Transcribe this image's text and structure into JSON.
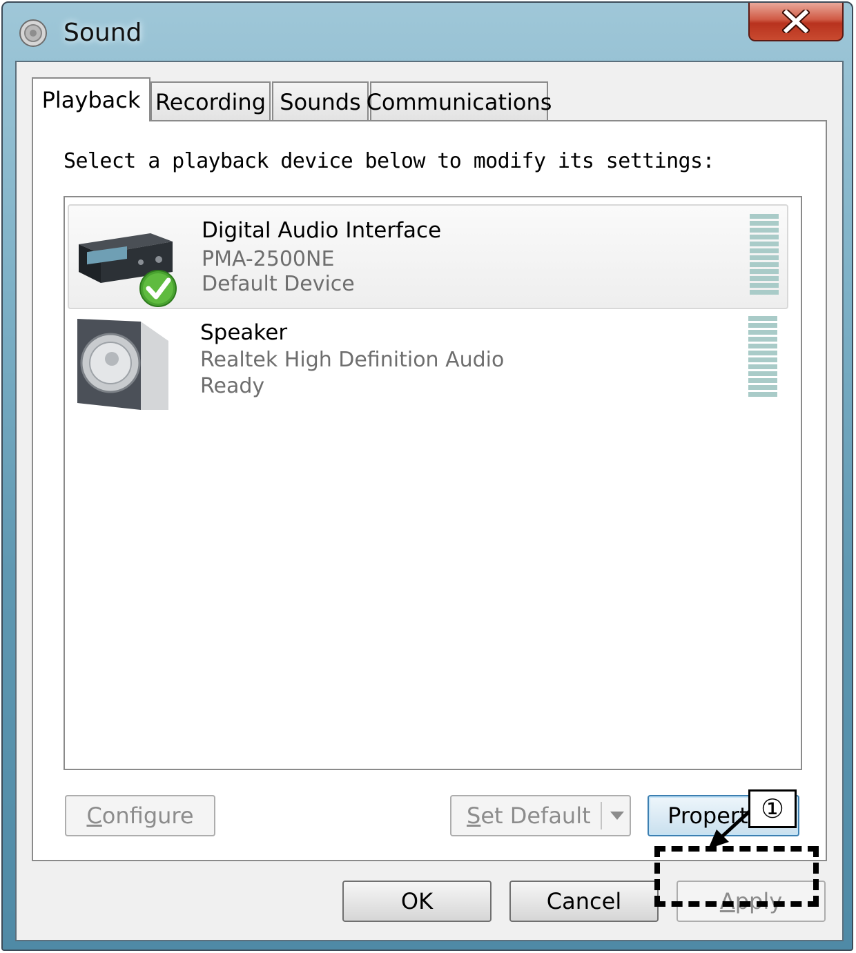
{
  "window": {
    "title": "Sound",
    "title_icon": "speaker-icon",
    "close_icon": "close-icon"
  },
  "tabs": [
    {
      "label": "Playback",
      "active": true
    },
    {
      "label": "Recording",
      "active": false
    },
    {
      "label": "Sounds",
      "active": false
    },
    {
      "label": "Communications",
      "active": false
    }
  ],
  "prompt": "Select a playback device below to modify its settings:",
  "devices": [
    {
      "name": "Digital Audio Interface",
      "model": "PMA-2500NE",
      "status": "Default Device",
      "icon": "audio-receiver-icon",
      "default_badge_icon": "checkmark-icon",
      "selected": true
    },
    {
      "name": "Speaker",
      "model": "Realtek High Definition Audio",
      "status": "Ready",
      "icon": "speaker-device-icon",
      "selected": false
    }
  ],
  "buttons": {
    "configure": {
      "mnemonic": "C",
      "rest": "onfigure",
      "enabled": false
    },
    "set_default": {
      "mnemonic": "S",
      "rest": "et Default",
      "enabled": false
    },
    "properties": {
      "label": "Properties",
      "enabled": true
    },
    "ok": {
      "label": "OK"
    },
    "cancel": {
      "label": "Cancel"
    },
    "apply": {
      "mnemonic": "A",
      "rest": "pply",
      "enabled": false
    }
  },
  "annotation": {
    "callout": "①"
  },
  "colors": {
    "meter": "#a9cbc8",
    "frame": "#7eb1c7",
    "close": "#c94a30"
  }
}
